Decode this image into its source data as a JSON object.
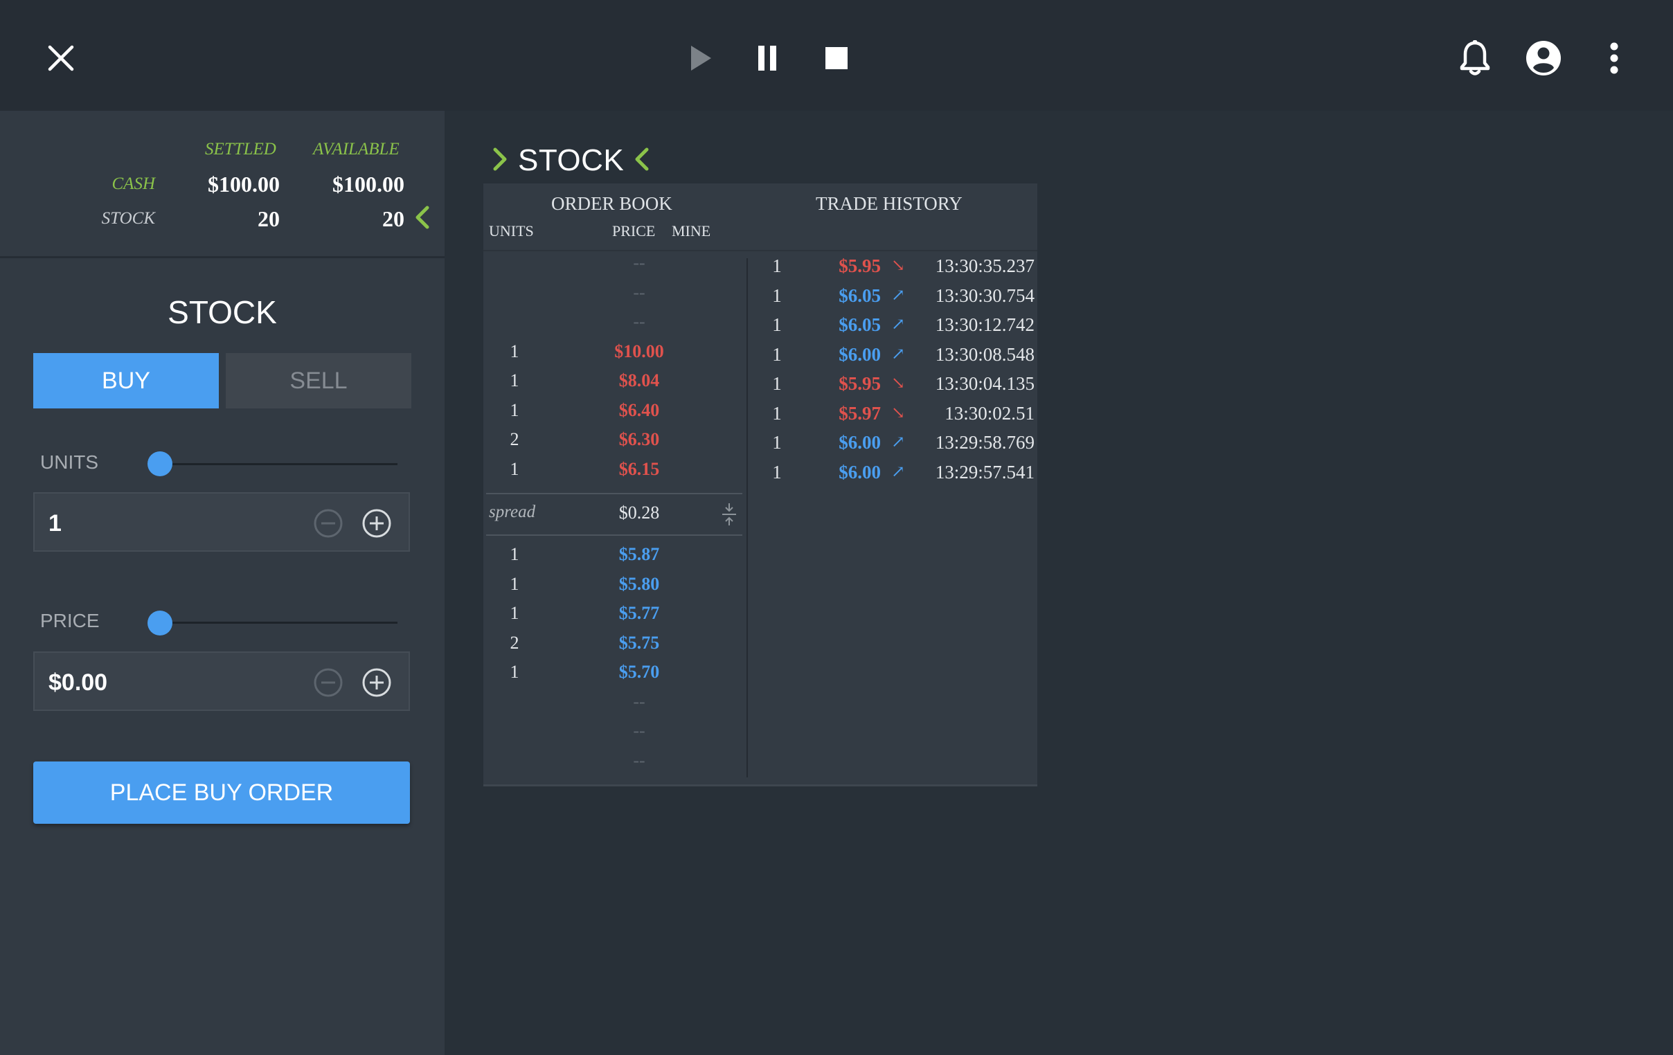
{
  "toolbar": {
    "icons": [
      "close-icon",
      "play-icon",
      "pause-icon",
      "stop-icon",
      "bell-icon",
      "account-icon",
      "more-vert-icon"
    ]
  },
  "balances": {
    "settled_label": "SETTLED",
    "available_label": "AVAILABLE",
    "cash_label": "CASH",
    "stock_label": "STOCK",
    "cash_settled": "$100.00",
    "cash_available": "$100.00",
    "stock_settled": "20",
    "stock_available": "20"
  },
  "order_form": {
    "title": "STOCK",
    "buy_label": "BUY",
    "sell_label": "SELL",
    "units_label": "UNITS",
    "units_value": "1",
    "units_slider_level": 0,
    "price_label": "PRICE",
    "price_value": "$0.00",
    "price_slider_level": 0,
    "submit_label": "PLACE BUY ORDER"
  },
  "market": {
    "title": "STOCK",
    "order_book_label": "ORDER BOOK",
    "trade_history_label": "TRADE HISTORY",
    "col_units": "UNITS",
    "col_price": "PRICE",
    "col_mine": "MINE",
    "asks": [
      {
        "units": "",
        "price": "--"
      },
      {
        "units": "",
        "price": "--"
      },
      {
        "units": "",
        "price": "--"
      },
      {
        "units": "1",
        "price": "$10.00"
      },
      {
        "units": "1",
        "price": "$8.04"
      },
      {
        "units": "1",
        "price": "$6.40"
      },
      {
        "units": "2",
        "price": "$6.30"
      },
      {
        "units": "1",
        "price": "$6.15"
      }
    ],
    "spread_label": "spread",
    "spread_value": "$0.28",
    "bids": [
      {
        "units": "1",
        "price": "$5.87"
      },
      {
        "units": "1",
        "price": "$5.80"
      },
      {
        "units": "1",
        "price": "$5.77"
      },
      {
        "units": "2",
        "price": "$5.75"
      },
      {
        "units": "1",
        "price": "$5.70"
      },
      {
        "units": "",
        "price": "--"
      },
      {
        "units": "",
        "price": "--"
      },
      {
        "units": "",
        "price": "--"
      }
    ],
    "trades": [
      {
        "units": "1",
        "price": "$5.95",
        "direction": "down",
        "arrow": "↘",
        "time": "13:30:35.237"
      },
      {
        "units": "1",
        "price": "$6.05",
        "direction": "up",
        "arrow": "↗",
        "time": "13:30:30.754"
      },
      {
        "units": "1",
        "price": "$6.05",
        "direction": "up",
        "arrow": "↗",
        "time": "13:30:12.742"
      },
      {
        "units": "1",
        "price": "$6.00",
        "direction": "up",
        "arrow": "↗",
        "time": "13:30:08.548"
      },
      {
        "units": "1",
        "price": "$5.95",
        "direction": "down",
        "arrow": "↘",
        "time": "13:30:04.135"
      },
      {
        "units": "1",
        "price": "$5.97",
        "direction": "down",
        "arrow": "↘",
        "time": "13:30:02.51"
      },
      {
        "units": "1",
        "price": "$6.00",
        "direction": "up",
        "arrow": "↗",
        "time": "13:29:58.769"
      },
      {
        "units": "1",
        "price": "$6.00",
        "direction": "up",
        "arrow": "↗",
        "time": "13:29:57.541"
      }
    ]
  },
  "colors": {
    "accent": "#4a9ef0",
    "ask": "#e0524d",
    "bid": "#4a9ef0",
    "label_green": "#8bc34a",
    "background": "#283038",
    "panel": "#323a43"
  }
}
